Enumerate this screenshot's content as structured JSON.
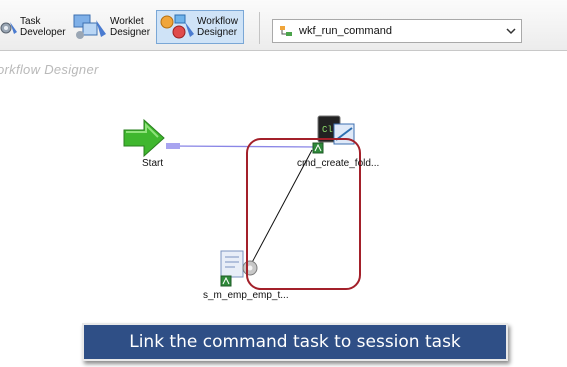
{
  "toolbar": {
    "task_developer": "Task\nDeveloper",
    "worklet_designer": "Worklet\nDesigner",
    "workflow_designer": "Workflow\nDesigner",
    "workflow_select": "wkf_run_command"
  },
  "canvas": {
    "title": "orkflow Designer"
  },
  "nodes": {
    "start": "Start",
    "command_task": "cmd_create_fold...",
    "command_icon_text": "Cl",
    "session_task": "s_m_emp_emp_t..."
  },
  "annotation": {
    "text": "Link the command task to session task",
    "highlight_color": "#a3202a"
  },
  "colors": {
    "banner_bg": "#2f4f86",
    "start_arrow": "#3fb72e",
    "link_line": "#8a86e6"
  }
}
